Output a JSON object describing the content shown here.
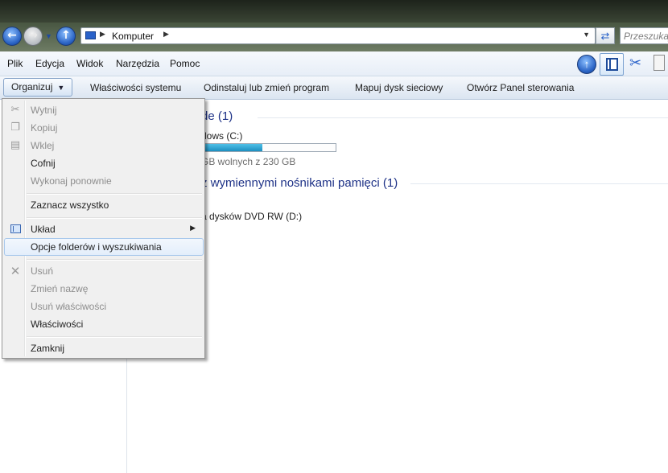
{
  "address": {
    "path_label": "Komputer",
    "search_placeholder": "Przeszukaj"
  },
  "menubar": {
    "items": [
      "Plik",
      "Edycja",
      "Widok",
      "Narzędzia",
      "Pomoc"
    ]
  },
  "toolbar": {
    "organize_label": "Organizuj",
    "commands": [
      "Właściwości systemu",
      "Odinstaluj lub zmień program",
      "Mapuj dysk sieciowy",
      "Otwórz Panel sterowania"
    ]
  },
  "content": {
    "hdd_group_header": "de (1)",
    "drive_c_name": "dows (C:)",
    "drive_c_free": "GB wolnych z 230 GB",
    "drive_c_used_fraction": 0.45,
    "removable_group_header": "z wymiennymi nośnikami pamięci (1)",
    "dvd_name": "a dysków DVD RW (D:)"
  },
  "organize_menu": {
    "items": [
      {
        "label": "Wytnij",
        "enabled": false,
        "icon": "cut-icon"
      },
      {
        "label": "Kopiuj",
        "enabled": false,
        "icon": "copy-icon"
      },
      {
        "label": "Wklej",
        "enabled": false,
        "icon": "paste-icon"
      },
      {
        "label": "Cofnij",
        "enabled": true
      },
      {
        "label": "Wykonaj ponownie",
        "enabled": false
      },
      {
        "label": "Zaznacz wszystko",
        "enabled": true
      },
      {
        "label": "Układ",
        "enabled": true,
        "icon": "layout-icon",
        "submenu": true
      },
      {
        "label": "Opcje folderów i wyszukiwania",
        "enabled": true,
        "highlighted": true
      },
      {
        "label": "Usuń",
        "enabled": false,
        "icon": "delete-icon"
      },
      {
        "label": "Zmień nazwę",
        "enabled": false
      },
      {
        "label": "Usuń właściwości",
        "enabled": false
      },
      {
        "label": "Właściwości",
        "enabled": true
      },
      {
        "label": "Zamknij",
        "enabled": true
      }
    ]
  }
}
